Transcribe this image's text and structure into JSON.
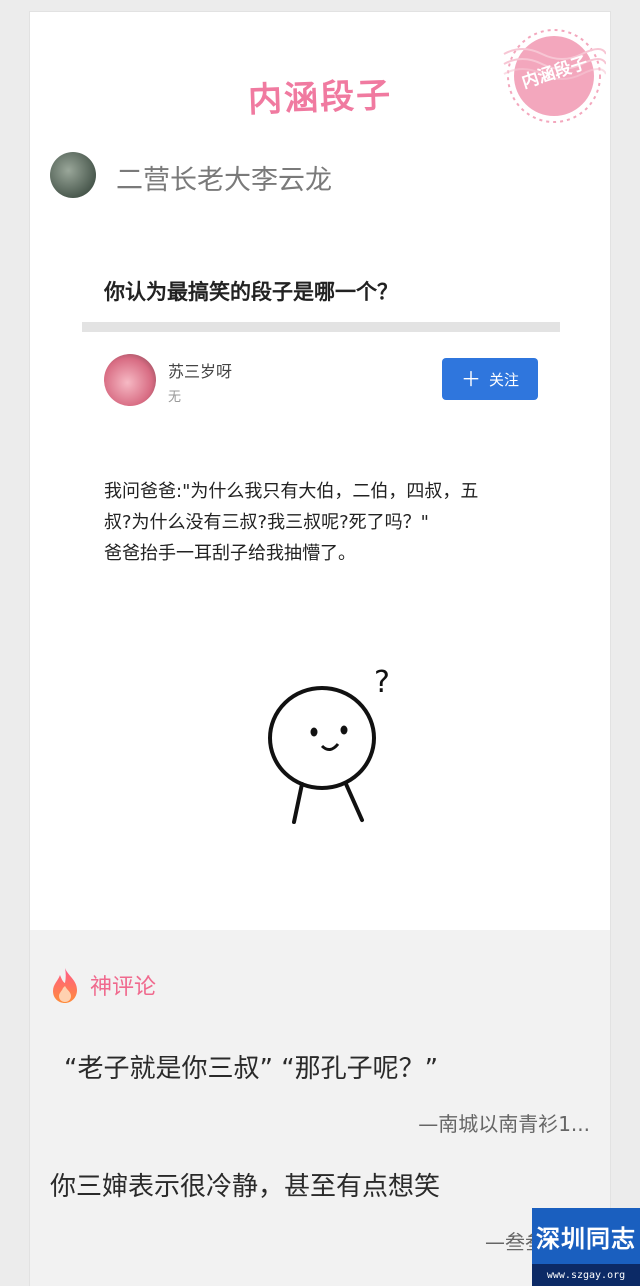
{
  "header": {
    "title": "内涵段子",
    "stamp_text": "内涵段子",
    "accent_color": "#f07aa0"
  },
  "author": {
    "name": "二营长老大李云龙"
  },
  "post_image": {
    "question": "你认为最搞笑的段子是哪一个？",
    "answerer": {
      "name": "苏三岁呀",
      "subtitle": "无"
    },
    "follow_button": {
      "icon": "plus-icon",
      "label": "关注",
      "color": "#2f76dd"
    },
    "answer_lines": [
      "我问爸爸:\"为什么我只有大伯，二伯，四叔，五",
      "叔?为什么没有三叔?我三叔呢?死了吗？\"",
      "爸爸抬手一耳刮子给我抽懵了。"
    ],
    "doodle_glyph": "?"
  },
  "comments": {
    "header_icon": "fire-icon",
    "header_label": "神评论",
    "items": [
      {
        "text": "“老子就是你三叔”   “那孔子呢？”",
        "signature": "—南城以南青衫1..."
      },
      {
        "text": "你三婶表示很冷静，甚至有点想笑",
        "signature": "—叁叁de酒"
      }
    ]
  },
  "watermark": {
    "name": "深圳同志",
    "url": "www.szgay.org"
  }
}
